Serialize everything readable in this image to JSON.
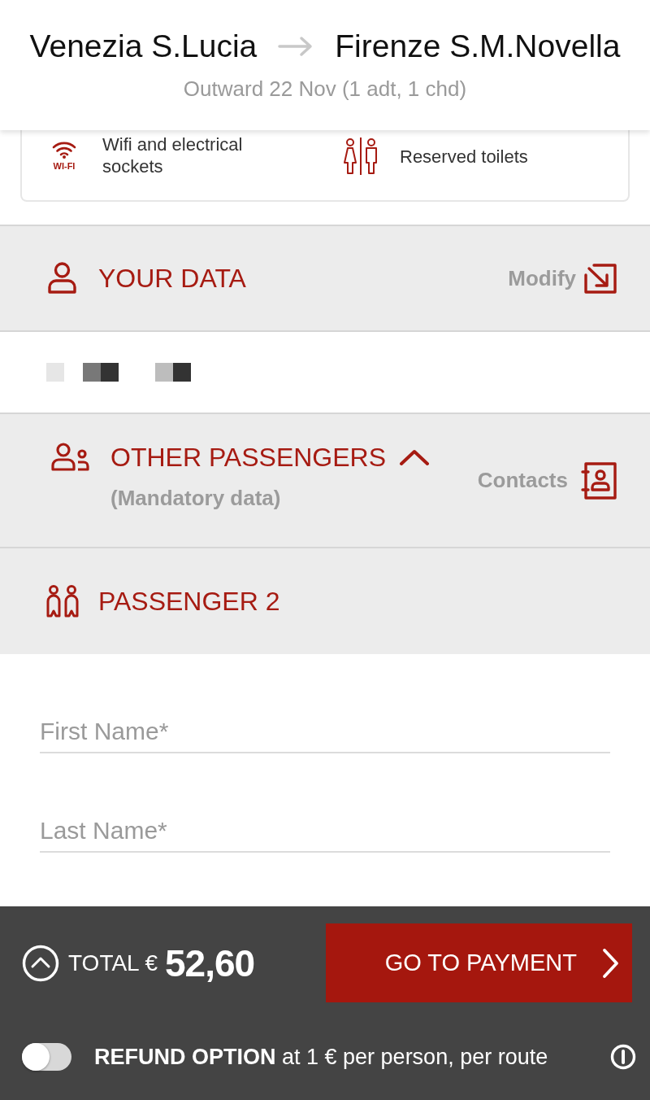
{
  "header": {
    "origin": "Venezia S.Lucia",
    "destination": "Firenze S.M.Novella",
    "subtitle": "Outward 22 Nov (1 adt, 1 chd)"
  },
  "amenities": [
    {
      "kind": "wifi",
      "icon_text": "WI-FI",
      "label": "Wifi and electrical sockets"
    },
    {
      "kind": "toilets",
      "label": "Reserved toilets"
    }
  ],
  "your_data": {
    "title": "YOUR DATA",
    "action": "Modify"
  },
  "other_passengers": {
    "title": "OTHER PASSENGERS",
    "subtitle": "(Mandatory data)",
    "expanded": true,
    "action": "Contacts"
  },
  "passenger": {
    "title": "PASSENGER 2",
    "fields": [
      {
        "placeholder": "First Name*"
      },
      {
        "placeholder": "Last Name*"
      }
    ]
  },
  "footer": {
    "total_label": "TOTAL €",
    "total": "52,60",
    "pay_button": "GO TO PAYMENT",
    "refund": {
      "on": false,
      "text": "**REFUND OPTION** at 1 € per person, per route"
    }
  }
}
